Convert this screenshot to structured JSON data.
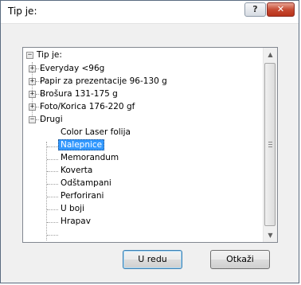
{
  "window": {
    "title": "Tip je:",
    "help_label": "?",
    "close_label": "✕"
  },
  "tree": {
    "root": "Tip je:",
    "nodes": [
      "Everyday <96g",
      "Papir za prezentacije 96-130 g",
      "Brošura 131-175 g",
      "Foto/Korica 176-220 gf",
      "Drugi"
    ],
    "children": [
      "Color Laser folija",
      "Nalepnice",
      "Memorandum",
      "Koverta",
      "Odštampani",
      "Perforirani",
      "U boji",
      "Hrapav"
    ],
    "selected": "Nalepnice"
  },
  "scrollbar": {
    "up_glyph": "▲",
    "down_glyph": "▼"
  },
  "buttons": {
    "ok": "U redu",
    "cancel": "Otkaži"
  }
}
